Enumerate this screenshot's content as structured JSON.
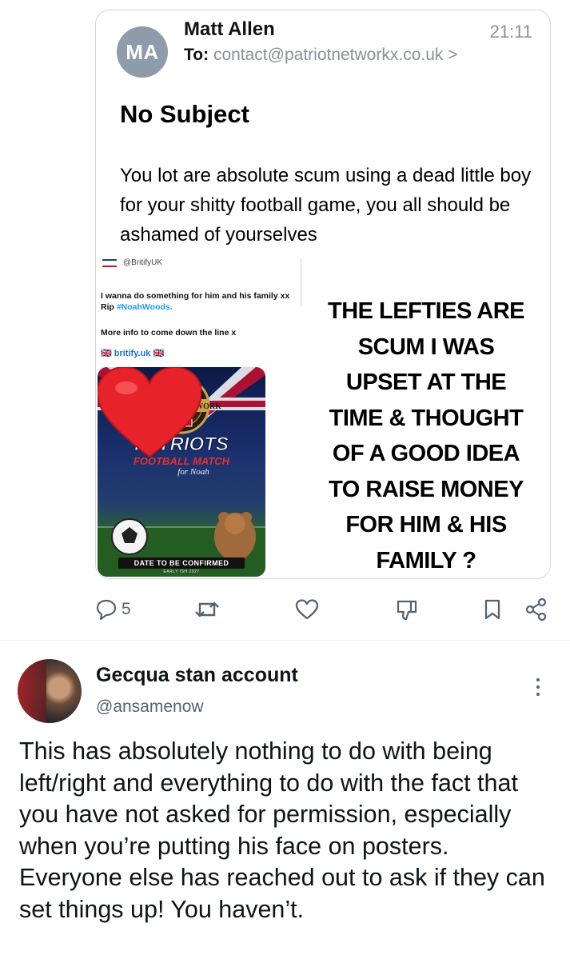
{
  "email": {
    "avatar_initials": "MA",
    "sender": "Matt Allen",
    "time": "21:11",
    "to_label": "To:",
    "to_address": "contact@patriotnetworkx.co.uk",
    "to_chevron": ">",
    "subject": "No Subject",
    "body": "You lot are absolute scum using a dead little boy for your shitty football game, you all should be ashamed of yourselves"
  },
  "embedded_tweet": {
    "logo_text": "BRITIFY",
    "handle": "@BritifyUK",
    "line1": "I wanna do something for him and his family xx Rip ",
    "hashtag": "#NoahWoods.",
    "line2": "More info to come down the line x",
    "site": "🇬🇧 britify.uk 🇬🇧",
    "poster": {
      "network_title": "PATRIOT NETWORK",
      "headline": "PATRIOTS",
      "subhead": "FOOTBALL MATCH",
      "script": "for Noah",
      "date_badge": "DATE TO BE CONFIRMED",
      "date_sub": "EARLY ISH 2027"
    }
  },
  "caption": "THE LEFTIES ARE\nSCUM I WAS\nUPSET AT THE\nTIME & THOUGHT\nOF A GOOD IDEA\nTO RAISE MONEY\nFOR HIM & HIS\nFAMILY ?",
  "actions": {
    "reply_count": "5",
    "icons": [
      "reply-icon",
      "retweet-icon",
      "like-icon",
      "dislike-icon",
      "bookmark-icon",
      "share-icon"
    ]
  },
  "reply": {
    "name": "Gecqua stan account",
    "handle": "@ansamenow",
    "text": "This has absolutely nothing to do with being left/right and everything to do with the fact that you have not asked for permission, especially when you’re putting his face on posters. Everyone else has reached out to ask if they can set things up! You haven’t."
  },
  "colors": {
    "link_blue": "#1d9bf0",
    "muted": "#536471",
    "heart_red": "#e8222a",
    "avatar_gray": "#8e9bab"
  }
}
